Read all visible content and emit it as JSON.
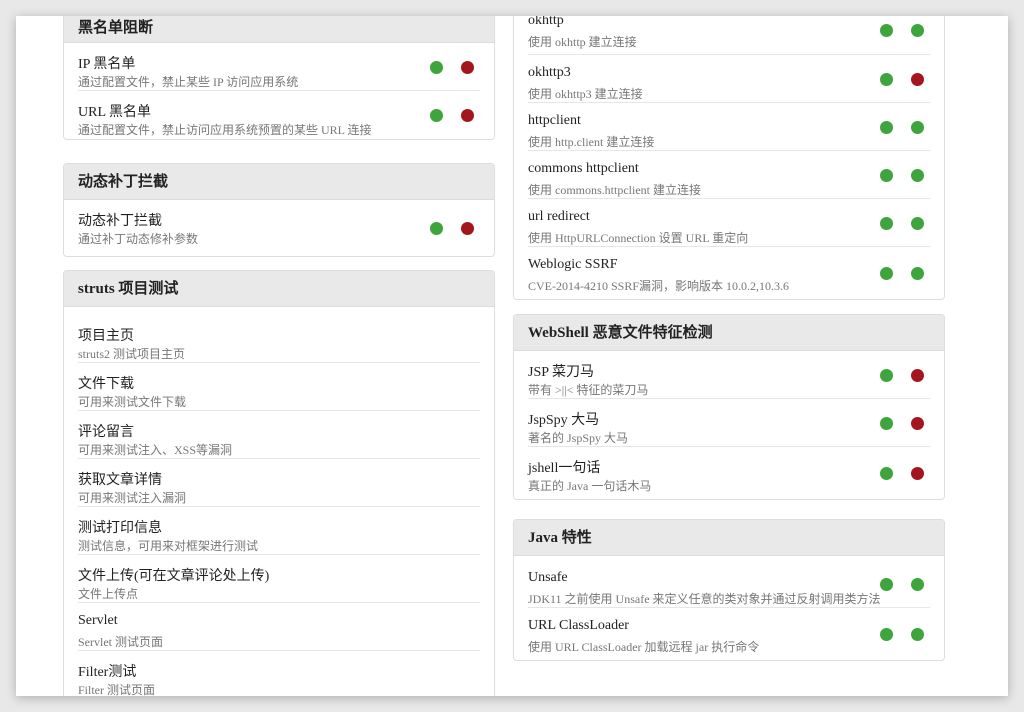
{
  "colors": {
    "green": "#3da53b",
    "red": "#a4161d",
    "header_bg": "#e9e9e9"
  },
  "left": {
    "blacklist": {
      "title": "黑名单阻断",
      "items": [
        {
          "title": "IP 黑名单",
          "desc": "通过配置文件，禁止某些 IP 访问应用系统",
          "status": [
            "green",
            "red"
          ]
        },
        {
          "title": "URL 黑名单",
          "desc": "通过配置文件，禁止访问应用系统预置的某些 URL 连接",
          "status": [
            "green",
            "red"
          ]
        }
      ]
    },
    "patch": {
      "title": "动态补丁拦截",
      "items": [
        {
          "title": "动态补丁拦截",
          "desc": "通过补丁动态修补参数",
          "status": [
            "green",
            "red"
          ]
        }
      ]
    },
    "struts": {
      "title": "struts 项目测试",
      "items": [
        {
          "title": "项目主页",
          "desc": "struts2 测试项目主页"
        },
        {
          "title": "文件下载",
          "desc": "可用来测试文件下载"
        },
        {
          "title": "评论留言",
          "desc": "可用来测试注入、XSS等漏洞"
        },
        {
          "title": "获取文章详情",
          "desc": "可用来测试注入漏洞"
        },
        {
          "title": "测试打印信息",
          "desc": "测试信息，可用来对框架进行测试"
        },
        {
          "title": "文件上传(可在文章评论处上传)",
          "desc": "文件上传点"
        },
        {
          "title": "Servlet",
          "desc": "Servlet 测试页面"
        },
        {
          "title": "Filter测试",
          "desc": "Filter 测试页面"
        }
      ]
    }
  },
  "right": {
    "ssrf": {
      "items": [
        {
          "title": "okhttp",
          "desc": "使用 okhttp 建立连接",
          "status": [
            "green",
            "green"
          ]
        },
        {
          "title": "okhttp3",
          "desc": "使用 okhttp3 建立连接",
          "status": [
            "green",
            "red"
          ]
        },
        {
          "title": "httpclient",
          "desc": "使用 http.client 建立连接",
          "status": [
            "green",
            "green"
          ]
        },
        {
          "title": "commons httpclient",
          "desc": "使用 commons.httpclient 建立连接",
          "status": [
            "green",
            "green"
          ]
        },
        {
          "title": "url redirect",
          "desc": "使用 HttpURLConnection 设置 URL 重定向",
          "status": [
            "green",
            "green"
          ]
        },
        {
          "title": "Weblogic SSRF",
          "desc": "CVE-2014-4210 SSRF漏洞，影响版本 10.0.2,10.3.6",
          "status": [
            "green",
            "green"
          ]
        }
      ]
    },
    "webshell": {
      "title": "WebShell 恶意文件特征检测",
      "items": [
        {
          "title": "JSP 菜刀马",
          "desc": "带有 >||< 特征的菜刀马",
          "status": [
            "green",
            "red"
          ]
        },
        {
          "title": "JspSpy 大马",
          "desc": "著名的 JspSpy 大马",
          "status": [
            "green",
            "red"
          ]
        },
        {
          "title": "jshell一句话",
          "desc": "真正的 Java 一句话木马",
          "status": [
            "green",
            "red"
          ]
        }
      ]
    },
    "java": {
      "title": "Java 特性",
      "items": [
        {
          "title": "Unsafe",
          "desc": "JDK11 之前使用 Unsafe 来定义任意的类对象并通过反射调用类方法",
          "status": [
            "green",
            "green"
          ]
        },
        {
          "title": "URL ClassLoader",
          "desc": "使用 URL ClassLoader 加载远程 jar 执行命令",
          "status": [
            "green",
            "green"
          ]
        }
      ]
    }
  }
}
